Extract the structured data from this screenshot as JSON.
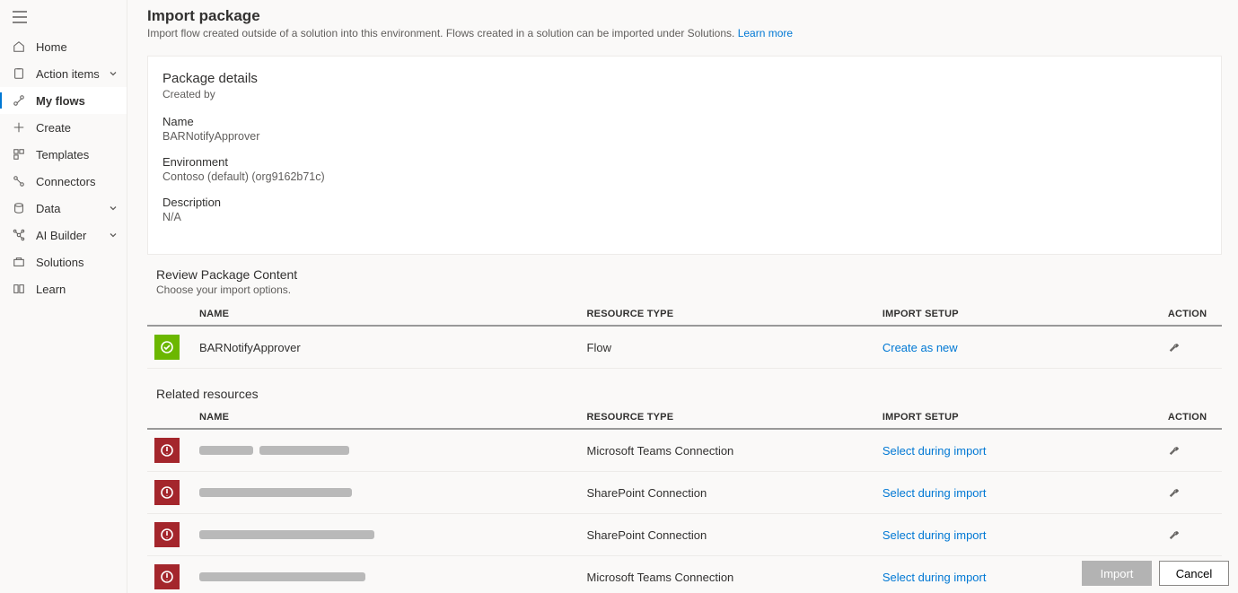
{
  "page": {
    "title": "Import package",
    "subtitle_text": "Import flow created outside of a solution into this environment. Flows created in a solution can be imported under Solutions. ",
    "learn_more": "Learn more"
  },
  "sidebar": {
    "items": [
      {
        "label": "Home",
        "icon": "home"
      },
      {
        "label": "Action items",
        "icon": "clipboard",
        "chevron": true
      },
      {
        "label": "My flows",
        "icon": "flow",
        "active": true
      },
      {
        "label": "Create",
        "icon": "plus"
      },
      {
        "label": "Templates",
        "icon": "template"
      },
      {
        "label": "Connectors",
        "icon": "connector"
      },
      {
        "label": "Data",
        "icon": "data",
        "chevron": true
      },
      {
        "label": "AI Builder",
        "icon": "ai",
        "chevron": true
      },
      {
        "label": "Solutions",
        "icon": "solution"
      },
      {
        "label": "Learn",
        "icon": "book"
      }
    ]
  },
  "details": {
    "section_title": "Package details",
    "created_by_label": "Created by",
    "name_label": "Name",
    "name_value": "BARNotifyApprover",
    "env_label": "Environment",
    "env_value": "Contoso (default) (org9162b71c)",
    "desc_label": "Description",
    "desc_value": "N/A"
  },
  "review": {
    "title": "Review Package Content",
    "subtitle": "Choose your import options.",
    "columns": {
      "name": "NAME",
      "type": "RESOURCE TYPE",
      "setup": "IMPORT SETUP",
      "action": "ACTION"
    },
    "rows": [
      {
        "status": "ok",
        "name": "BARNotifyApprover",
        "type": "Flow",
        "setup": "Create as new"
      }
    ]
  },
  "related": {
    "title": "Related resources",
    "columns": {
      "name": "NAME",
      "type": "RESOURCE TYPE",
      "setup": "IMPORT SETUP",
      "action": "ACTION"
    },
    "rows": [
      {
        "status": "err",
        "type": "Microsoft Teams Connection",
        "setup": "Select during import"
      },
      {
        "status": "err",
        "type": "SharePoint Connection",
        "setup": "Select during import"
      },
      {
        "status": "err",
        "type": "SharePoint Connection",
        "setup": "Select during import"
      },
      {
        "status": "err",
        "type": "Microsoft Teams Connection",
        "setup": "Select during import"
      }
    ]
  },
  "footer": {
    "import": "Import",
    "cancel": "Cancel"
  }
}
